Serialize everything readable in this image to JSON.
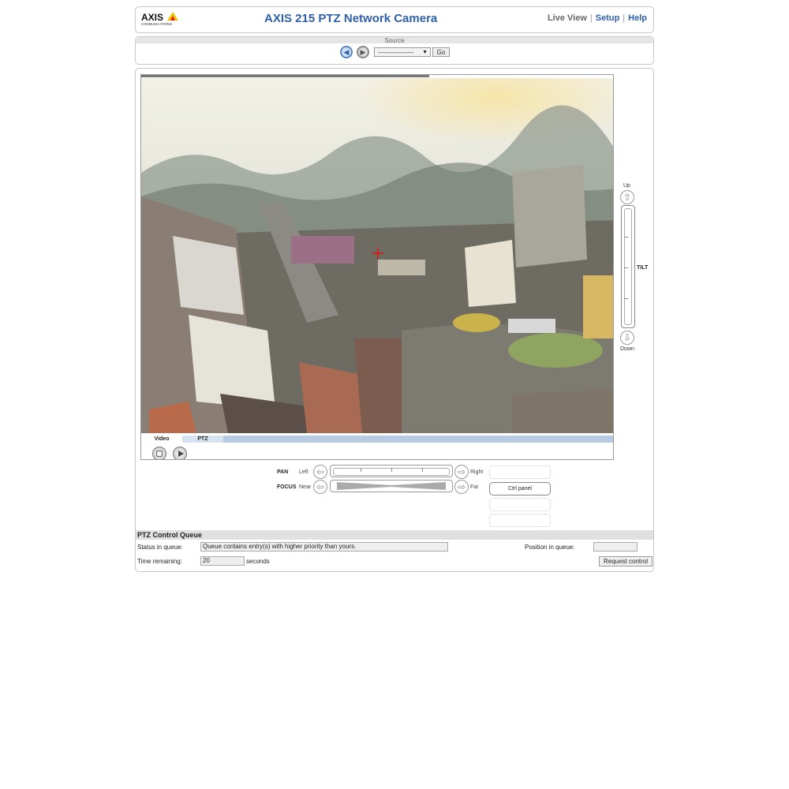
{
  "header": {
    "logo_text": "AXIS",
    "logo_subtext": "COMMUNICATIONS",
    "title": "AXIS 215 PTZ Network Camera",
    "nav": {
      "live_view": "Live View",
      "setup": "Setup",
      "help": "Help",
      "separator": "|"
    }
  },
  "source": {
    "label": "Source",
    "selected": "-----------------",
    "go_label": "Go"
  },
  "video": {
    "tabs": [
      "Video",
      "PTZ"
    ],
    "buffer_progress": 0.61
  },
  "tilt": {
    "label": "TILT",
    "up_label": "Up",
    "down_label": "Down"
  },
  "pan": {
    "label": "PAN",
    "left_label": "Left",
    "right_label": "Right"
  },
  "focus": {
    "label": "FOCUS",
    "near_label": "Near",
    "far_label": "Far"
  },
  "side_buttons": {
    "ctrl_panel": "Ctrl panel"
  },
  "queue": {
    "header": "PTZ Control Queue",
    "status_label": "Status in queue:",
    "status_value": "Queue contains entry(s) with higher priority than yours.",
    "position_label": "Position in queue:",
    "position_value": "",
    "time_label": "Time remaining:",
    "time_value": "20",
    "time_unit": "seconds",
    "request_label": "Request control"
  },
  "colors": {
    "brand_blue": "#2e5fa8",
    "crosshair": "#e01010",
    "tab_strip": "#b7cbe2"
  }
}
